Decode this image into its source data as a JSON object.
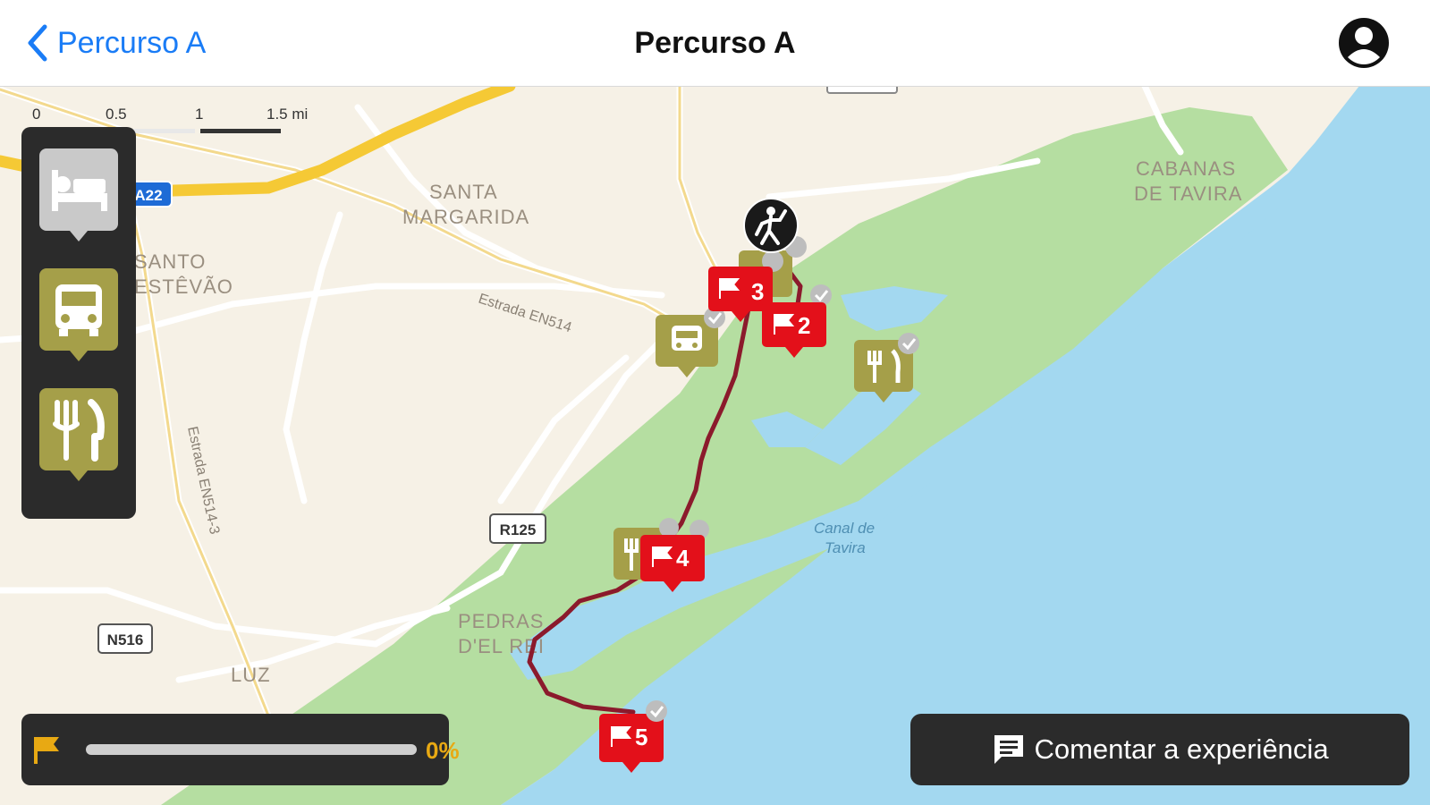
{
  "nav": {
    "back_label": "Percurso A",
    "title": "Percurso A"
  },
  "colors": {
    "accent_blue": "#1a7cf6",
    "marker_red": "#e3101a",
    "poi_olive": "#a59f49",
    "route": "#8b1a2c",
    "progress_yellow": "#e8a913",
    "sea": "#a3d8f0",
    "land": "#f6f1e6",
    "park_green": "#b5dea1"
  },
  "map": {
    "scale": {
      "ticks": [
        "0",
        "0.5",
        "1",
        "1.5 mi"
      ]
    },
    "place_labels": [
      "SANTA",
      "MARGARIDA",
      "SANTO",
      "ESTÊVÃO",
      "CABANAS",
      "DE TAVIRA",
      "PEDRAS",
      "D'EL REI",
      "LUZ"
    ],
    "road_labels": [
      "Estrada EN514",
      "Estrada EN514-3"
    ],
    "road_shields": [
      "A22",
      "R125",
      "N516"
    ],
    "water_labels": [
      "Canal de",
      "Tavira"
    ],
    "markers": [
      {
        "type": "flag",
        "number": "2"
      },
      {
        "type": "flag",
        "number": "3"
      },
      {
        "type": "flag",
        "number": "4"
      },
      {
        "type": "flag",
        "number": "5"
      },
      {
        "type": "poi",
        "icon": "bus-icon"
      },
      {
        "type": "poi",
        "icon": "restaurant-icon"
      },
      {
        "type": "poi",
        "icon": "restaurant-icon"
      },
      {
        "type": "user-position",
        "icon": "hiker-icon"
      }
    ]
  },
  "poi_filters": [
    {
      "icon": "bed-icon",
      "active": false
    },
    {
      "icon": "bus-icon",
      "active": true
    },
    {
      "icon": "restaurant-icon",
      "active": true
    }
  ],
  "progress": {
    "percent_label": "0%",
    "value": 0
  },
  "comment_button": {
    "label": "Comentar a experiência"
  }
}
